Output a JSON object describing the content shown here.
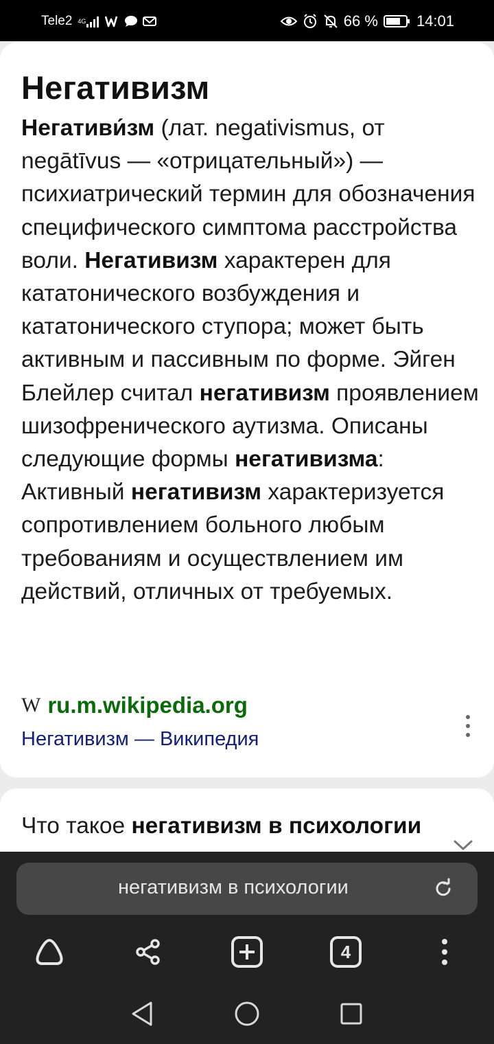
{
  "status_bar": {
    "carrier": "Tele2",
    "network_type": "4G",
    "battery": "66 %",
    "time": "14:01"
  },
  "article": {
    "title": "Негативизм",
    "body_runs": [
      {
        "text": "Негативи́зм",
        "bold": true
      },
      {
        "text": " (лат. negativismus, от negātīvus — «отрицательный») — психиатрический термин для обозначения специфического симптома расстройства воли. ",
        "bold": false
      },
      {
        "text": "Негативизм",
        "bold": true
      },
      {
        "text": " характерен для кататонического возбуждения и кататонического ступора; может быть активным и пассивным по форме. Эйген Блейлер считал ",
        "bold": false
      },
      {
        "text": "негативизм",
        "bold": true
      },
      {
        "text": " проявлением шизофренического аутизма. Описаны следующие формы ",
        "bold": false
      },
      {
        "text": "негативизма",
        "bold": true
      },
      {
        "text": ": Активный ",
        "bold": false
      },
      {
        "text": "негативизм",
        "bold": true
      },
      {
        "text": " характеризуется сопротивлением больного любым требованиям и осуществлением им действий, отличных от требуемых.",
        "bold": false
      }
    ],
    "source_logo": "W",
    "source_domain": "ru.m.wikipedia.org",
    "source_link": "Негативизм — Википедия"
  },
  "next_card": {
    "prefix": "Что такое ",
    "bold": "негативизм в психологии"
  },
  "browser": {
    "url_text": "негативизм в психологии",
    "tabs_count": "4"
  },
  "colors": {
    "domain_green": "#0b6b0b",
    "link_blue": "#13207a",
    "bar_bg": "#222222",
    "url_bg": "#474747"
  }
}
